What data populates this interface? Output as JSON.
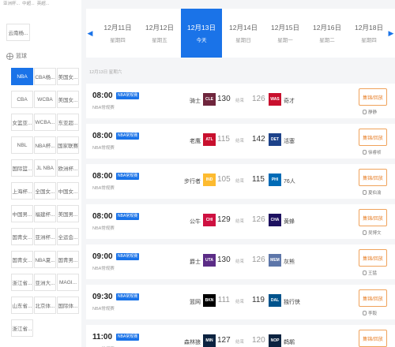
{
  "sidebar": {
    "top_tabs": [
      "亚洲杯...",
      "中超...",
      "英超..."
    ],
    "first_item": "云南杨...",
    "section_label": "篮球",
    "chips": [
      {
        "label": "NBA",
        "active": true
      },
      {
        "label": "CBA杨...",
        "active": false
      },
      {
        "label": "美国女...",
        "active": false
      },
      {
        "label": "CBA",
        "active": false
      },
      {
        "label": "WCBA",
        "active": false
      },
      {
        "label": "美国女...",
        "active": false
      },
      {
        "label": "女篮亚...",
        "active": false
      },
      {
        "label": "WCBA...",
        "active": false
      },
      {
        "label": "东亚超...",
        "active": false
      },
      {
        "label": "NBL",
        "active": false
      },
      {
        "label": "NBA杯...",
        "active": false
      },
      {
        "label": "国家联赛",
        "active": false
      },
      {
        "label": "国际篮...",
        "active": false
      },
      {
        "label": "JL NBA",
        "active": false
      },
      {
        "label": "欧洲杯...",
        "active": false
      },
      {
        "label": "上海杯...",
        "active": false
      },
      {
        "label": "全国女...",
        "active": false
      },
      {
        "label": "中国女...",
        "active": false
      },
      {
        "label": "中国男...",
        "active": false
      },
      {
        "label": "福建杯...",
        "active": false
      },
      {
        "label": "美国男...",
        "active": false
      },
      {
        "label": "国青女...",
        "active": false
      },
      {
        "label": "亚洲杯...",
        "active": false
      },
      {
        "label": "全运会...",
        "active": false
      },
      {
        "label": "国青女...",
        "active": false
      },
      {
        "label": "NBA夏...",
        "active": false
      },
      {
        "label": "国青男...",
        "active": false
      },
      {
        "label": "浙江省...",
        "active": false
      },
      {
        "label": "亚洲大...",
        "active": false
      },
      {
        "label": "MAGI...",
        "active": false
      },
      {
        "label": "山东省...",
        "active": false
      },
      {
        "label": "北京体...",
        "active": false
      },
      {
        "label": "国际体...",
        "active": false
      },
      {
        "label": "浙江省...",
        "active": false
      }
    ]
  },
  "datebar": {
    "prev_icon": "chevron-left-icon",
    "next_icon": "chevron-right-icon",
    "dates": [
      {
        "date": "12月11日",
        "weekday": "星期四",
        "active": false
      },
      {
        "date": "12月12日",
        "weekday": "星期五",
        "active": false
      },
      {
        "date": "12月13日",
        "weekday": "今天",
        "active": true
      },
      {
        "date": "12月14日",
        "weekday": "星期日",
        "active": false
      },
      {
        "date": "12月15日",
        "weekday": "星期一",
        "active": false
      },
      {
        "date": "12月16日",
        "weekday": "星期二",
        "active": false
      },
      {
        "date": "12月18日",
        "weekday": "星期四",
        "active": false
      }
    ]
  },
  "sub_label": "12月13日 星期六",
  "matches": [
    {
      "time": "08:00",
      "tag": "NBA常规赛",
      "comp": "NBA常规赛",
      "home": "骑士",
      "home_score": "130",
      "vs": "结束",
      "away_score": "126",
      "away": "奇才",
      "home_color": "#6f263d",
      "away_color": "#c8102e",
      "home_abbr": "CLE",
      "away_abbr": "WAS",
      "home_win": true,
      "watch": "集锦/回放",
      "commentator": "静静"
    },
    {
      "time": "08:00",
      "tag": "NBA常规赛",
      "comp": "NBA常规赛",
      "home": "老鹰",
      "home_score": "115",
      "vs": "结束",
      "away_score": "142",
      "away": "活塞",
      "home_color": "#c8102e",
      "away_color": "#1d428a",
      "home_abbr": "ATL",
      "away_abbr": "DET",
      "home_win": false,
      "watch": "集锦/回放",
      "commentator": "徐睿桢"
    },
    {
      "time": "08:00",
      "tag": "NBA常规赛",
      "comp": "NBA常规赛",
      "home": "步行者",
      "home_score": "105",
      "vs": "结束",
      "away_score": "115",
      "away": "76人",
      "home_color": "#fdbb30",
      "away_color": "#006bb6",
      "home_abbr": "IND",
      "away_abbr": "PHI",
      "home_win": false,
      "watch": "集锦/回放",
      "commentator": "夏伯渝"
    },
    {
      "time": "08:00",
      "tag": "NBA常规赛",
      "comp": "NBA常规赛",
      "home": "公牛",
      "home_score": "129",
      "vs": "结束",
      "away_score": "126",
      "away": "黄蜂",
      "home_color": "#ce1141",
      "away_color": "#1d1160",
      "home_abbr": "CHI",
      "away_abbr": "CHA",
      "home_win": true,
      "watch": "集锦/回放",
      "commentator": "吴博文"
    },
    {
      "time": "09:00",
      "tag": "NBA常规赛",
      "comp": "NBA常规赛",
      "home": "爵士",
      "home_score": "130",
      "vs": "结束",
      "away_score": "126",
      "away": "灰熊",
      "home_color": "#5b2c86",
      "away_color": "#5d76a9",
      "home_abbr": "UTA",
      "away_abbr": "MEM",
      "home_win": true,
      "watch": "集锦/回放",
      "commentator": "王猛"
    },
    {
      "time": "09:30",
      "tag": "NBA常规赛",
      "comp": "NBA常规赛",
      "home": "篮网",
      "home_score": "111",
      "vs": "结束",
      "away_score": "119",
      "away": "独行侠",
      "home_color": "#000000",
      "away_color": "#00538c",
      "home_abbr": "BKN",
      "away_abbr": "DAL",
      "home_win": false,
      "watch": "集锦/回放",
      "commentator": "李毅"
    },
    {
      "time": "11:00",
      "tag": "NBA常规赛",
      "comp": "NBA常规赛",
      "home": "森林狼",
      "home_score": "127",
      "vs": "结束",
      "away_score": "120",
      "away": "鹈鹕",
      "home_color": "#0c2340",
      "away_color": "#0c2340",
      "home_abbr": "MIN",
      "away_abbr": "NOP",
      "home_win": true,
      "watch": "集锦/回放",
      "commentator": "杨毅"
    }
  ]
}
